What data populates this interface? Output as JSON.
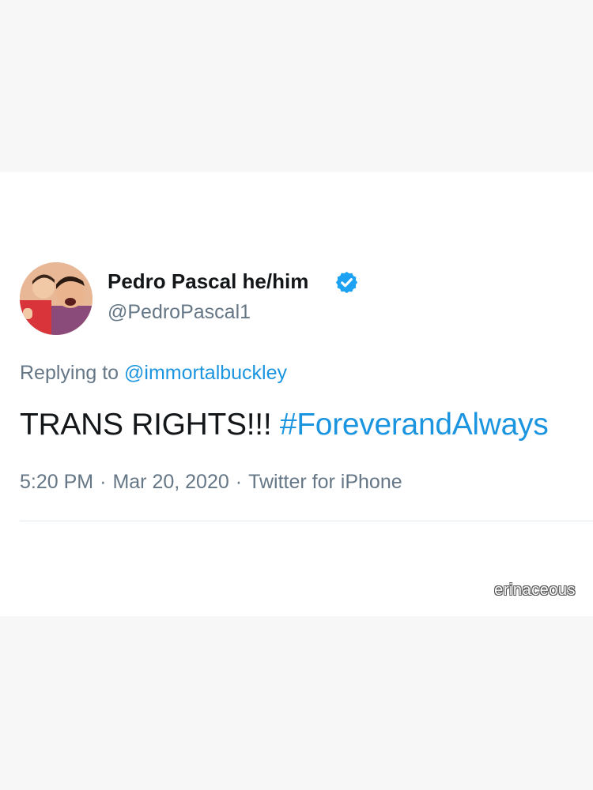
{
  "tweet": {
    "display_name": "Pedro Pascal he/him",
    "handle": "@PedroPascal1",
    "verified_icon": "verified-badge-icon",
    "replying_prefix": "Replying to ",
    "replying_to": "@immortalbuckley",
    "text": "TRANS RIGHTS!!! ",
    "hashtag": "#ForeverandAlways",
    "time": "5:20 PM",
    "date": "Mar 20, 2020",
    "source": "Twitter for iPhone",
    "separator": "·"
  },
  "watermark": "erinaceous",
  "colors": {
    "link": "#1b95e0",
    "muted": "#657786",
    "text": "#14171a",
    "verified": "#1da1f2",
    "background": "#f7f7f7",
    "card": "#ffffff"
  }
}
